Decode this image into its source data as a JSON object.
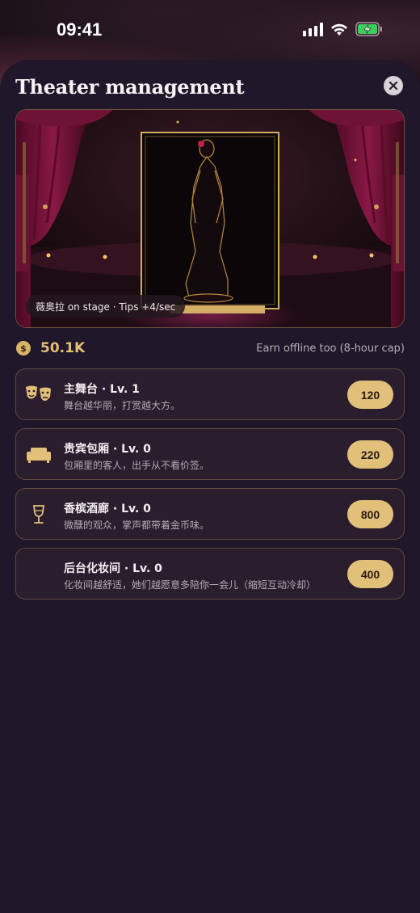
{
  "status_bar": {
    "time": "09:41"
  },
  "sheet": {
    "title": "Theater management",
    "stage_caption": "薇奥拉 on stage · Tips +4/sec"
  },
  "wallet": {
    "coin_symbol": "$",
    "amount": "50.1K",
    "offline_note": "Earn offline too (8-hour cap)"
  },
  "upgrades": [
    {
      "icon": "theater-masks-icon",
      "title": "主舞台 · Lv. 1",
      "description": "舞台越华丽，打赏越大方。",
      "cost": "120"
    },
    {
      "icon": "sofa-icon",
      "title": "贵宾包厢 · Lv. 0",
      "description": "包厢里的客人，出手从不看价签。",
      "cost": "220"
    },
    {
      "icon": "wine-glass-icon",
      "title": "香槟酒廊 · Lv. 0",
      "description": "微醺的观众，掌声都带着金币味。",
      "cost": "800"
    },
    {
      "icon": "",
      "title": "后台化妆间 · Lv. 0",
      "description": "化妆间越舒适，她们越愿意多陪你一会儿（缩短互动冷却）",
      "cost": "400"
    }
  ],
  "colors": {
    "accent_gold": "#e2c07a",
    "sheet_bg": "#21172a",
    "card_border": "#5c4a3c",
    "curtain": "#8a1846"
  }
}
